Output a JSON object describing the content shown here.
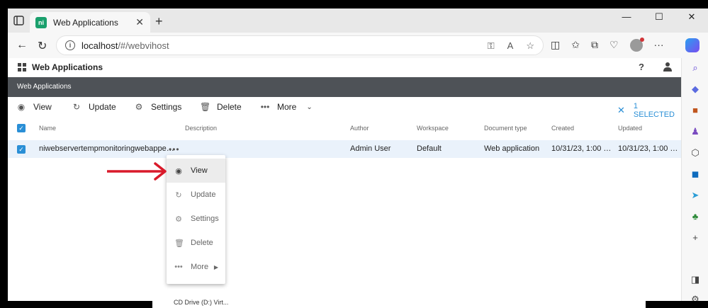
{
  "browser": {
    "tab_title": "Web Applications",
    "tab_favicon": "ni",
    "url_host": "localhost",
    "url_path": "/#/webvihost",
    "window_controls": [
      "—",
      "☐",
      "✕"
    ]
  },
  "app": {
    "title": "Web Applications",
    "banner": "Web Applications",
    "help": "?"
  },
  "actions": {
    "view": "View",
    "update": "Update",
    "settings": "Settings",
    "delete": "Delete",
    "more": "More",
    "selected": "1 SELECTED"
  },
  "table": {
    "columns": [
      "Name",
      "Description",
      "Author",
      "Workspace",
      "Document type",
      "Created",
      "Updated"
    ],
    "rows": [
      {
        "name": "niwebservertempmonitoringwebappe…",
        "description": "",
        "author": "Admin User",
        "workspace": "Default",
        "document_type": "Web application",
        "created": "10/31/23, 1:00 …",
        "updated": "10/31/23, 1:00 …"
      }
    ]
  },
  "context_menu": {
    "items": [
      {
        "label": "View",
        "icon": "eye-icon"
      },
      {
        "label": "Update",
        "icon": "update-icon"
      },
      {
        "label": "Settings",
        "icon": "gear-icon"
      },
      {
        "label": "Delete",
        "icon": "trash-icon"
      },
      {
        "label": "More",
        "icon": "dots-icon"
      }
    ]
  },
  "colors": {
    "accent": "#2a8fd6",
    "banner": "#4e5257",
    "selected_row": "#eaf2fb",
    "annotation_arrow": "#d91a2a"
  },
  "bottom_strip_text": "CD Drive (D:) Virt..."
}
